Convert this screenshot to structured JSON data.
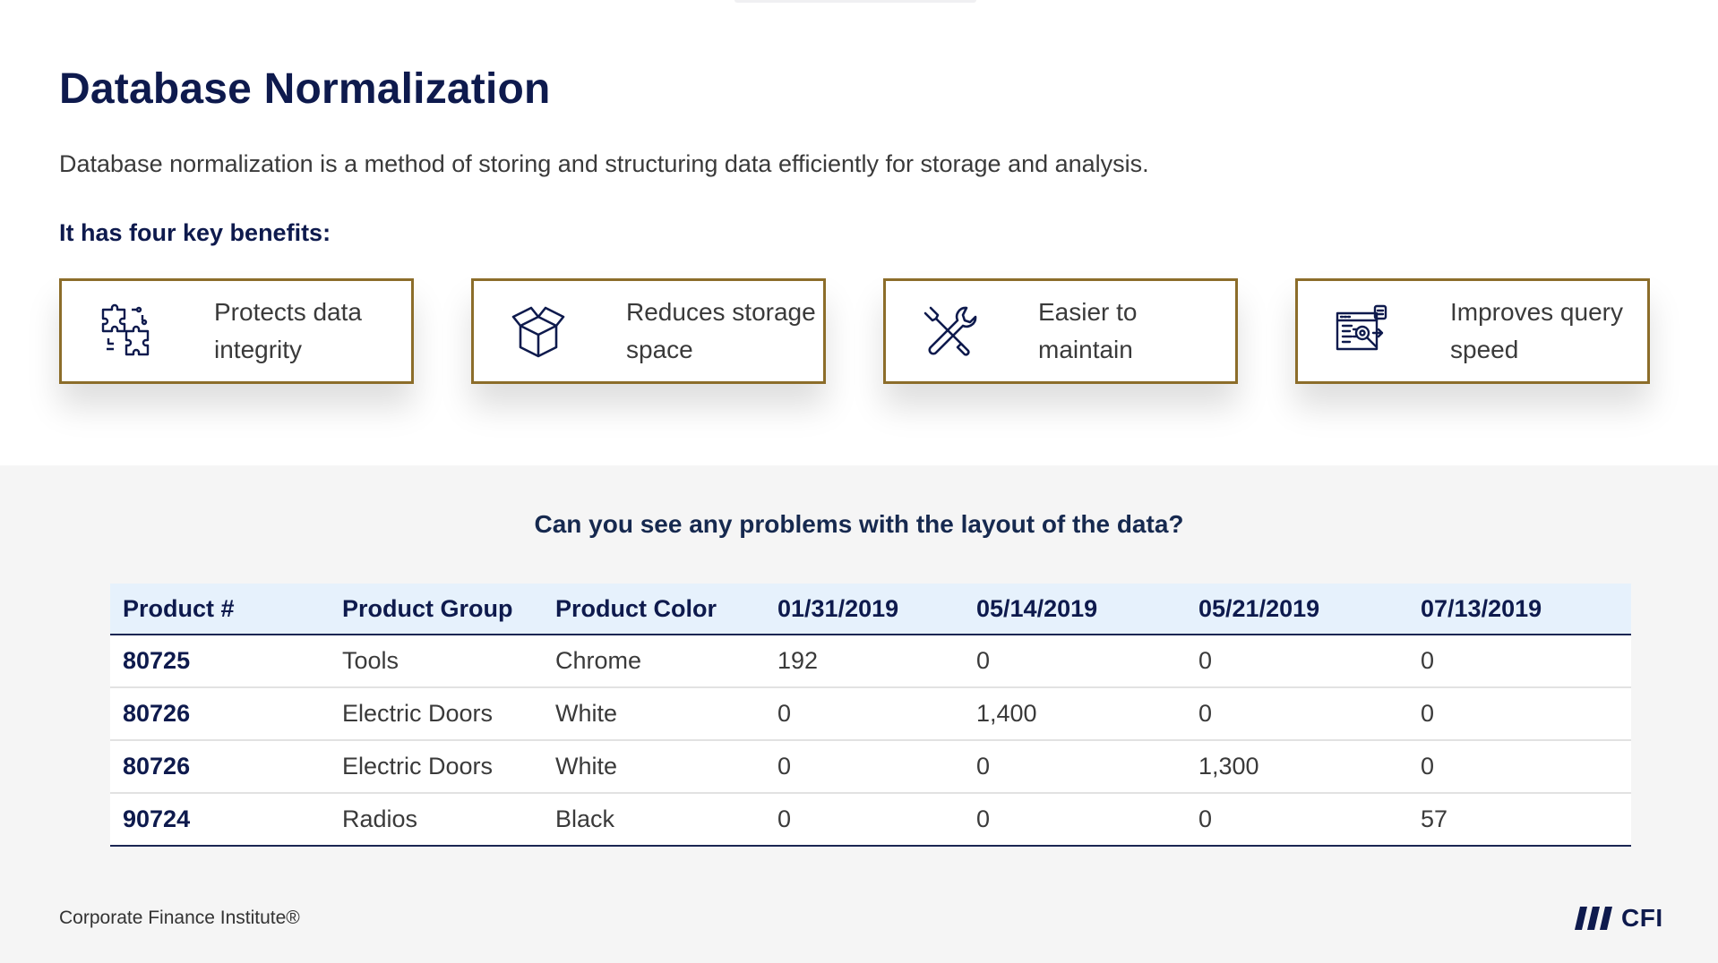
{
  "title": "Database Normalization",
  "subtitle": "Database normalization is a method of storing and structuring data efficiently for storage and analysis.",
  "benefits_heading": "It has four key benefits:",
  "benefits": [
    {
      "icon": "puzzle-icon",
      "label": "Protects data integrity"
    },
    {
      "icon": "box-icon",
      "label": "Reduces storage space"
    },
    {
      "icon": "tools-icon",
      "label": "Easier to maintain"
    },
    {
      "icon": "query-speed-icon",
      "label": "Improves query speed"
    }
  ],
  "question": "Can you see any problems with the layout of the data?",
  "table": {
    "headers": [
      "Product #",
      "Product Group",
      "Product Color",
      "01/31/2019",
      "05/14/2019",
      "05/21/2019",
      "07/13/2019"
    ],
    "rows": [
      [
        "80725",
        "Tools",
        "Chrome",
        "192",
        "0",
        "0",
        "0"
      ],
      [
        "80726",
        "Electric Doors",
        "White",
        "0",
        "1,400",
        "0",
        "0"
      ],
      [
        "80726",
        "Electric Doors",
        "White",
        "0",
        "0",
        "1,300",
        "0"
      ],
      [
        "90724",
        "Radios",
        "Black",
        "0",
        "0",
        "0",
        "57"
      ]
    ]
  },
  "footer": "Corporate Finance Institute®",
  "logo_text": "CFI",
  "colors": {
    "navy": "#0e1a4d",
    "card_border": "#8c6d2a",
    "header_fill": "#e6f1fc",
    "lower_bg": "#f5f5f5"
  }
}
